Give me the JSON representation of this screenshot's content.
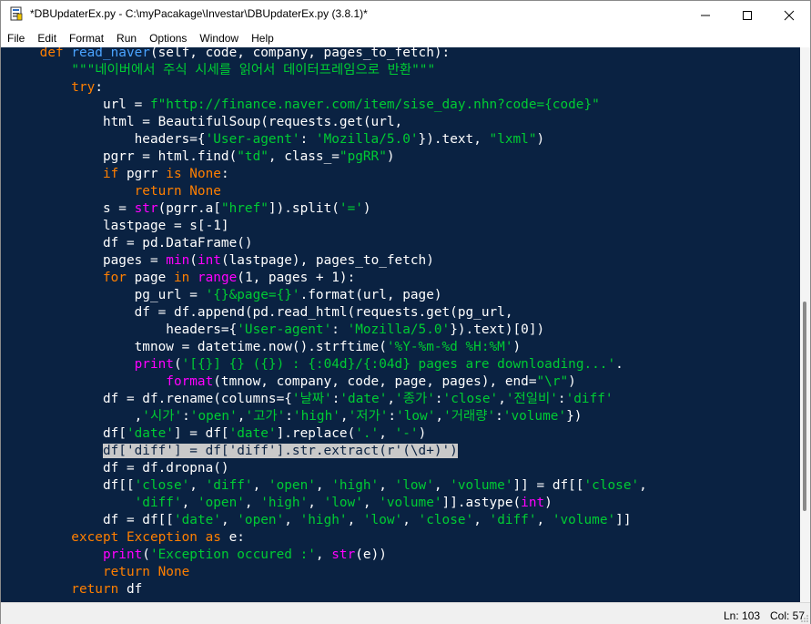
{
  "window": {
    "title": "*DBUpdaterEx.py - C:\\myPacakage\\Investar\\DBUpdaterEx.py (3.8.1)*",
    "icons": {
      "app": "idle-file-icon",
      "minimize": "minimize-icon",
      "maximize": "maximize-icon",
      "close": "close-icon"
    }
  },
  "menu": [
    "File",
    "Edit",
    "Format",
    "Run",
    "Options",
    "Window",
    "Help"
  ],
  "colors": {
    "editor_bg": "#0a2242",
    "keyword": "#ff7f00",
    "builtin": "#ff00ff",
    "string": "#00cc33",
    "definition": "#4aa3ff",
    "text": "#ffffff",
    "selection": "#c9c9c9"
  },
  "code_lines": [
    {
      "t": [
        [
          "kw",
          "    def "
        ],
        [
          "fn",
          "read_naver"
        ],
        [
          "",
          "(self, code, company, pages_to_fetch):"
        ]
      ]
    },
    {
      "t": [
        [
          "",
          "        "
        ],
        [
          "str",
          "\"\"\"네이버에서 주식 시세를 읽어서 데이터프레임으로 반환\"\"\""
        ]
      ]
    },
    {
      "t": [
        [
          "kw",
          "        try"
        ],
        [
          "",
          ":"
        ]
      ]
    },
    {
      "t": [
        [
          "",
          "            url = "
        ],
        [
          "str",
          "f\"http://finance.naver.com/item/sise_day.nhn?code={code}\""
        ]
      ]
    },
    {
      "t": [
        [
          "",
          "            html = BeautifulSoup(requests.get(url,"
        ]
      ]
    },
    {
      "t": [
        [
          "",
          "                headers={"
        ],
        [
          "str",
          "'User-agent'"
        ],
        [
          "",
          ": "
        ],
        [
          "str",
          "'Mozilla/5.0'"
        ],
        [
          "",
          "}).text, "
        ],
        [
          "str",
          "\"lxml\""
        ],
        [
          "",
          ")"
        ]
      ]
    },
    {
      "t": [
        [
          "",
          "            pgrr = html.find("
        ],
        [
          "str",
          "\"td\""
        ],
        [
          "",
          ", class_="
        ],
        [
          "str",
          "\"pgRR\""
        ],
        [
          "",
          ")"
        ]
      ]
    },
    {
      "t": [
        [
          "kw",
          "            if "
        ],
        [
          "",
          "pgrr "
        ],
        [
          "kw",
          "is None"
        ],
        [
          "",
          ":"
        ]
      ]
    },
    {
      "t": [
        [
          "kw",
          "                return None"
        ]
      ]
    },
    {
      "t": [
        [
          "",
          "            s = "
        ],
        [
          "bi",
          "str"
        ],
        [
          "",
          "(pgrr.a["
        ],
        [
          "str",
          "\"href\""
        ],
        [
          "",
          "]).split("
        ],
        [
          "str",
          "'='"
        ],
        [
          "",
          ")"
        ]
      ]
    },
    {
      "t": [
        [
          "",
          "            lastpage = s[-1]"
        ]
      ]
    },
    {
      "t": [
        [
          "",
          "            df = pd.DataFrame()"
        ]
      ]
    },
    {
      "t": [
        [
          "",
          "            pages = "
        ],
        [
          "bi",
          "min"
        ],
        [
          "",
          "("
        ],
        [
          "bi",
          "int"
        ],
        [
          "",
          "(lastpage), pages_to_fetch)"
        ]
      ]
    },
    {
      "t": [
        [
          "kw",
          "            for "
        ],
        [
          "",
          "page "
        ],
        [
          "kw",
          "in "
        ],
        [
          "bi",
          "range"
        ],
        [
          "",
          "(1, pages + 1):"
        ]
      ]
    },
    {
      "t": [
        [
          "",
          "                pg_url = "
        ],
        [
          "str",
          "'{}&page={}'"
        ],
        [
          "",
          ".format(url, page)"
        ]
      ]
    },
    {
      "t": [
        [
          "",
          "                df = df.append(pd.read_html(requests.get(pg_url,"
        ]
      ]
    },
    {
      "t": [
        [
          "",
          "                    headers={"
        ],
        [
          "str",
          "'User-agent'"
        ],
        [
          "",
          ": "
        ],
        [
          "str",
          "'Mozilla/5.0'"
        ],
        [
          "",
          "}).text)[0])"
        ]
      ]
    },
    {
      "t": [
        [
          "",
          "                tmnow = datetime.now().strftime("
        ],
        [
          "str",
          "'%Y-%m-%d %H:%M'"
        ],
        [
          "",
          ")"
        ]
      ]
    },
    {
      "t": [
        [
          "bi",
          "                print"
        ],
        [
          "",
          "("
        ],
        [
          "str",
          "'[{}] {} ({}) : {:04d}/{:04d} pages are downloading...'"
        ],
        [
          "",
          "."
        ]
      ]
    },
    {
      "t": [
        [
          "bi",
          "                    format"
        ],
        [
          "",
          "(tmnow, company, code, page, pages), end="
        ],
        [
          "str",
          "\"\\r\""
        ],
        [
          "",
          ")"
        ]
      ]
    },
    {
      "t": [
        [
          "",
          "            df = df.rename(columns={"
        ],
        [
          "str",
          "'날짜'"
        ],
        [
          "",
          ":"
        ],
        [
          "str",
          "'date'"
        ],
        [
          "",
          ","
        ],
        [
          "str",
          "'종가'"
        ],
        [
          "",
          ":"
        ],
        [
          "str",
          "'close'"
        ],
        [
          "",
          ","
        ],
        [
          "str",
          "'전일비'"
        ],
        [
          "",
          ":"
        ],
        [
          "str",
          "'diff'"
        ]
      ]
    },
    {
      "t": [
        [
          "",
          "                ,"
        ],
        [
          "str",
          "'시가'"
        ],
        [
          "",
          ":"
        ],
        [
          "str",
          "'open'"
        ],
        [
          "",
          ","
        ],
        [
          "str",
          "'고가'"
        ],
        [
          "",
          ":"
        ],
        [
          "str",
          "'high'"
        ],
        [
          "",
          ","
        ],
        [
          "str",
          "'저가'"
        ],
        [
          "",
          ":"
        ],
        [
          "str",
          "'low'"
        ],
        [
          "",
          ","
        ],
        [
          "str",
          "'거래량'"
        ],
        [
          "",
          ":"
        ],
        [
          "str",
          "'volume'"
        ],
        [
          "",
          "})"
        ]
      ]
    },
    {
      "t": [
        [
          "",
          "            df["
        ],
        [
          "str",
          "'date'"
        ],
        [
          "",
          "] = df["
        ],
        [
          "str",
          "'date'"
        ],
        [
          "",
          "].replace("
        ],
        [
          "str",
          "'.'"
        ],
        [
          "",
          ", "
        ],
        [
          "str",
          "'-'"
        ],
        [
          "",
          ")"
        ]
      ]
    },
    {
      "hl": true,
      "t": [
        [
          "",
          "            "
        ],
        [
          "hl",
          "df['diff'] = df['diff'].str.extract(r'(\\d+)')"
        ]
      ]
    },
    {
      "t": [
        [
          "",
          "            df = df.dropna()"
        ]
      ]
    },
    {
      "t": [
        [
          "",
          "            df[["
        ],
        [
          "str",
          "'close'"
        ],
        [
          "",
          ", "
        ],
        [
          "str",
          "'diff'"
        ],
        [
          "",
          ", "
        ],
        [
          "str",
          "'open'"
        ],
        [
          "",
          ", "
        ],
        [
          "str",
          "'high'"
        ],
        [
          "",
          ", "
        ],
        [
          "str",
          "'low'"
        ],
        [
          "",
          ", "
        ],
        [
          "str",
          "'volume'"
        ],
        [
          "",
          "]] = df[["
        ],
        [
          "str",
          "'close'"
        ],
        [
          "",
          ","
        ]
      ]
    },
    {
      "t": [
        [
          "",
          "                "
        ],
        [
          "str",
          "'diff'"
        ],
        [
          "",
          ", "
        ],
        [
          "str",
          "'open'"
        ],
        [
          "",
          ", "
        ],
        [
          "str",
          "'high'"
        ],
        [
          "",
          ", "
        ],
        [
          "str",
          "'low'"
        ],
        [
          "",
          ", "
        ],
        [
          "str",
          "'volume'"
        ],
        [
          "",
          "]].astype("
        ],
        [
          "bi",
          "int"
        ],
        [
          "",
          ")"
        ]
      ]
    },
    {
      "t": [
        [
          "",
          "            df = df[["
        ],
        [
          "str",
          "'date'"
        ],
        [
          "",
          ", "
        ],
        [
          "str",
          "'open'"
        ],
        [
          "",
          ", "
        ],
        [
          "str",
          "'high'"
        ],
        [
          "",
          ", "
        ],
        [
          "str",
          "'low'"
        ],
        [
          "",
          ", "
        ],
        [
          "str",
          "'close'"
        ],
        [
          "",
          ", "
        ],
        [
          "str",
          "'diff'"
        ],
        [
          "",
          ", "
        ],
        [
          "str",
          "'volume'"
        ],
        [
          "",
          "]]"
        ]
      ]
    },
    {
      "t": [
        [
          "kw",
          "        except "
        ],
        [
          "kw",
          "Exception "
        ],
        [
          "kw",
          "as "
        ],
        [
          "",
          "e:"
        ]
      ]
    },
    {
      "t": [
        [
          "bi",
          "            print"
        ],
        [
          "",
          "("
        ],
        [
          "str",
          "'Exception occured :'"
        ],
        [
          "",
          ", "
        ],
        [
          "bi",
          "str"
        ],
        [
          "",
          "(e))"
        ]
      ]
    },
    {
      "t": [
        [
          "kw",
          "            return None"
        ]
      ]
    },
    {
      "t": [
        [
          "kw",
          "        return "
        ],
        [
          "",
          "df"
        ]
      ]
    }
  ],
  "status": {
    "line": "Ln: 103",
    "col": "Col: 57"
  }
}
